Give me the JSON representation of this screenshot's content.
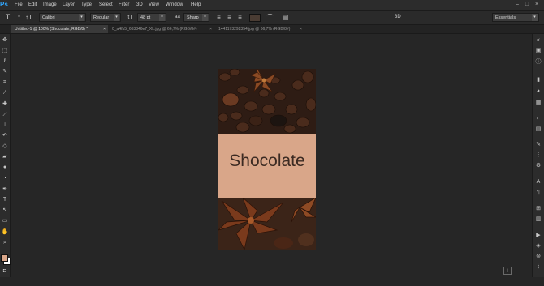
{
  "menubar": {
    "app_logo": "Ps",
    "items": [
      "File",
      "Edit",
      "Image",
      "Layer",
      "Type",
      "Select",
      "Filter",
      "3D",
      "View",
      "Window",
      "Help"
    ],
    "window_controls": [
      "–",
      "□",
      "×"
    ]
  },
  "options_bar": {
    "font_family": "Calibri",
    "font_style": "Regular",
    "font_size": "48 pt",
    "antialias": "Sharp",
    "text_color": "#4a3c33",
    "mode_3d": "3D",
    "workspace": "Essentials"
  },
  "tabs": [
    {
      "label": "Untitled-1 @ 100% (Shocolate, RGB/8) *",
      "active": true
    },
    {
      "label": "0_a4fb5_663846e7_XL.jpg @ 66,7% (RGB/8#)",
      "active": false
    },
    {
      "label": "1441173292354.jpg @ 66,7% (RGB/8#)",
      "active": false
    }
  ],
  "canvas": {
    "text": "Shocolate",
    "band_color": "#d9a689"
  },
  "swatches": {
    "foreground": "#d9a689",
    "background": "#ffffff"
  }
}
